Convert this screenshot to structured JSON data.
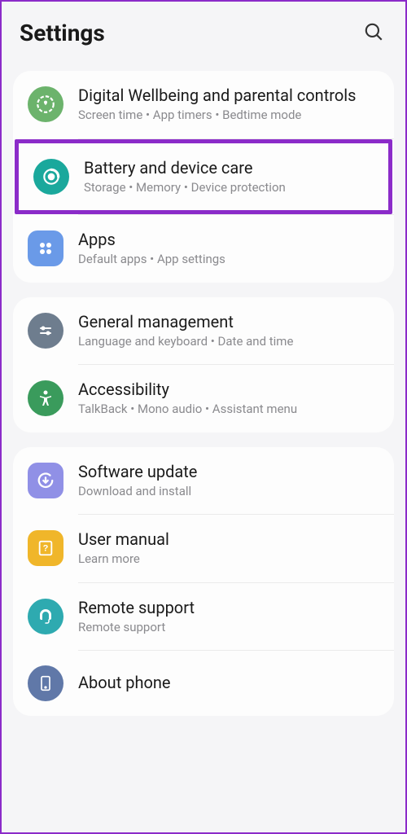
{
  "header": {
    "title": "Settings"
  },
  "groups": [
    {
      "items": [
        {
          "title": "Digital Wellbeing and parental controls",
          "sub": "Screen time  •  App timers  •  Bedtime mode"
        },
        {
          "title": "Battery and device care",
          "sub": "Storage  •  Memory  •  Device protection"
        },
        {
          "title": "Apps",
          "sub": "Default apps  •  App settings"
        }
      ]
    },
    {
      "items": [
        {
          "title": "General management",
          "sub": "Language and keyboard  •  Date and time"
        },
        {
          "title": "Accessibility",
          "sub": "TalkBack  •  Mono audio  •  Assistant menu"
        }
      ]
    },
    {
      "items": [
        {
          "title": "Software update",
          "sub": "Download and install"
        },
        {
          "title": "User manual",
          "sub": "Learn more"
        },
        {
          "title": "Remote support",
          "sub": "Remote support"
        },
        {
          "title": "About phone",
          "sub": ""
        }
      ]
    }
  ]
}
